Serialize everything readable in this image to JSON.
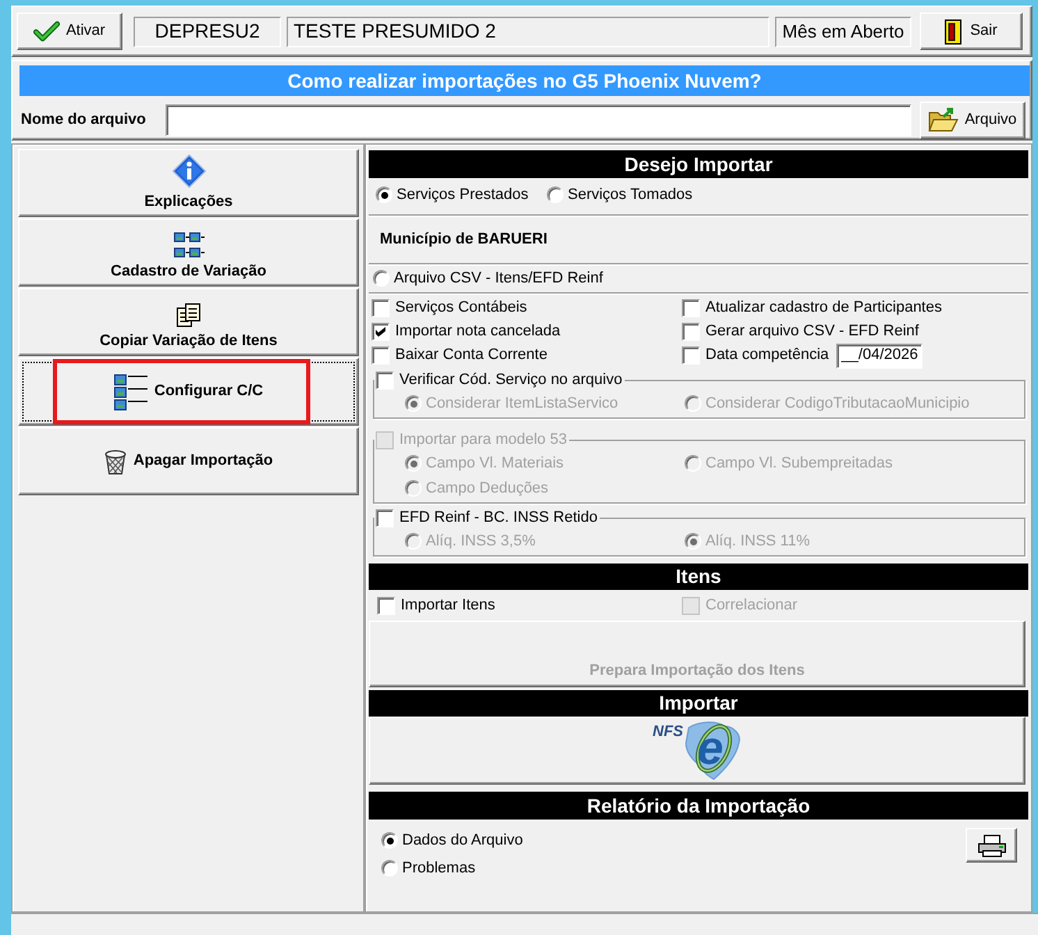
{
  "toolbar": {
    "activate_button": {
      "label": "Ativar"
    },
    "company_code": "DEPRESU2",
    "company_name": "TESTE PRESUMIDO 2",
    "period_status": "Mês em Aberto",
    "exit_button": {
      "label": "Sair"
    }
  },
  "help_banner": {
    "title": "Como realizar importações no G5 Phoenix Nuvem?"
  },
  "file_row": {
    "label": "Nome do arquivo",
    "browse_button": {
      "label": "Arquivo"
    }
  },
  "sidebar": {
    "items": [
      {
        "kind": "info",
        "label": "Explicações",
        "focused": false,
        "highlighted": false
      },
      {
        "kind": "variation",
        "label": "Cadastro de Variação",
        "focused": false,
        "highlighted": false
      },
      {
        "kind": "copy",
        "label": "Copiar Variação de Itens",
        "focused": false,
        "highlighted": false
      },
      {
        "kind": "configure",
        "label": "Configurar C/C",
        "focused": true,
        "highlighted": true
      },
      {
        "kind": "delete",
        "label": "Apagar Importação",
        "focused": false,
        "highlighted": false
      }
    ]
  },
  "import_options": {
    "header": "Desejo Importar",
    "service_types": [
      {
        "label": "Serviços Prestados",
        "selected": true
      },
      {
        "label": "Serviços Tomados",
        "selected": false
      }
    ],
    "municipality": "Município de BARUERI",
    "csv_option": {
      "label": "Arquivo CSV - Itens/EFD Reinf",
      "selected": false
    },
    "checkboxes": [
      {
        "label": "Serviços Contábeis",
        "checked": false
      },
      {
        "label": "Atualizar cadastro de Participantes",
        "checked": false
      },
      {
        "label": "Importar nota cancelada",
        "checked": true
      },
      {
        "label": "Gerar arquivo CSV - EFD Reinf",
        "checked": false
      },
      {
        "label": "Baixar Conta Corrente",
        "checked": false
      },
      {
        "label": "Data competência",
        "checked": false,
        "date": "__/04/2026"
      }
    ],
    "groups": [
      {
        "label": "Verificar Cód. Serviço no arquivo",
        "checked": false,
        "disabled": false,
        "options": [
          {
            "label": "Considerar ItemListaServico",
            "selected": true,
            "disabled": true
          },
          {
            "label": "Considerar CodigoTributacaoMunicipio",
            "selected": false,
            "disabled": true
          }
        ]
      },
      {
        "label": "Importar para modelo 53",
        "checked": false,
        "disabled": true,
        "options": [
          {
            "label": "Campo Vl. Materiais",
            "selected": true,
            "disabled": true
          },
          {
            "label": "Campo Vl. Subempreitadas",
            "selected": false,
            "disabled": true
          },
          {
            "label": "Campo Deduções",
            "selected": false,
            "disabled": true
          }
        ]
      },
      {
        "label": "EFD Reinf - BC. INSS Retido",
        "checked": false,
        "disabled": false,
        "options": [
          {
            "label": "Alíq. INSS 3,5%",
            "selected": false,
            "disabled": true
          },
          {
            "label": "Alíq. INSS 11%",
            "selected": true,
            "disabled": true
          }
        ]
      }
    ]
  },
  "items_section": {
    "header": "Itens",
    "checkboxes": [
      {
        "label": "Importar Itens",
        "checked": false,
        "disabled": false
      },
      {
        "label": "Correlacionar",
        "checked": false,
        "disabled": true
      }
    ],
    "prepare_button": {
      "label": "Prepara Importação dos Itens",
      "disabled": true
    }
  },
  "import_section": {
    "header": "Importar",
    "logo": {
      "prefix": "NFS",
      "letter": "e"
    }
  },
  "report_section": {
    "header": "Relatório da Importação",
    "options": [
      {
        "label": "Dados do Arquivo",
        "selected": true
      },
      {
        "label": "Problemas",
        "selected": false
      }
    ]
  }
}
